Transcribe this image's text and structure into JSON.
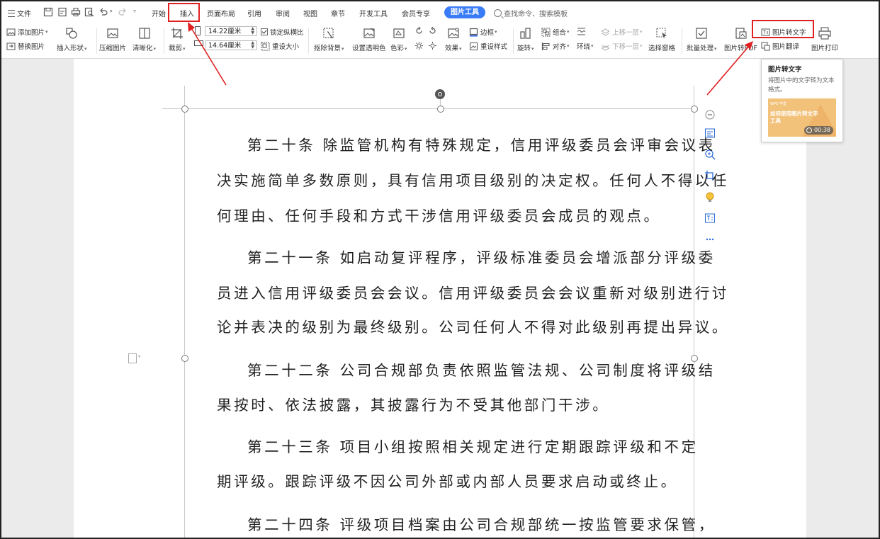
{
  "menubar": {
    "file_label": "文件",
    "tabs": [
      "开始",
      "插入",
      "页面布局",
      "引用",
      "审阅",
      "视图",
      "章节",
      "开发工具",
      "会员专享"
    ],
    "active_context_tab": "图片工具",
    "search_placeholder": "查找命令、搜索模板"
  },
  "ribbon": {
    "add_picture": "添加图片",
    "replace_picture": "替换图片",
    "insert_shape": "插入形状",
    "compress_picture": "压缩图片",
    "sharpen": "清晰化",
    "crop": "裁剪",
    "width_value": "14.22厘米",
    "height_value": "14.64厘米",
    "lock_aspect": "锁定纵横比",
    "reset_size": "重设大小",
    "remove_background": "抠除背景",
    "set_transparent": "设置透明色",
    "color": "色彩",
    "effects": "效果",
    "border": "边框",
    "reset_style": "重设样式",
    "rotate": "旋转",
    "group": "组合",
    "align": "对齐",
    "wrap": "环绕",
    "bring_forward": "上移一层",
    "send_backward": "下移一层",
    "selection_pane": "选择窗格",
    "batch_process": "批量处理",
    "picture_to_pdf": "图片转PDF",
    "picture_to_text": "图片转文字",
    "picture_translate": "图片翻译",
    "picture_print": "图片打印"
  },
  "document": {
    "lines": [
      "第二十条   除监管机构有特殊规定，信用评级委员会评审会议表",
      "决实施简单多数原则，具有信用项目级别的决定权。任何人不得以任",
      "何理由、任何手段和方式干涉信用评级委员会成员的观点。",
      "第二十一条   如启动复评程序，评级标准委员会增派部分评级委",
      "员进入信用评级委员会会议。信用评级委员会会议重新对级别进行讨",
      "论并表决的级别为最终级别。公司任何人不得对此级别再提出异议。",
      "第二十二条   公司合规部负责依照监管法规、公司制度将评级结",
      "果按时、依法披露，其披露行为不受其他部门干涉。",
      "第二十三条   项目小组按照相关规定进行定期跟踪评级和不定",
      "期评级。跟踪评级不因公司外部或内部人员要求启动或终止。",
      "第二十四条   评级项目档案由公司合规部统一按监管要求保管，"
    ]
  },
  "tooltip": {
    "title": "图片转文字",
    "description": "将图片中的文字转为文本格式。",
    "video_small": "WPS 学堂",
    "video_text": "如何使用图片转文字工具",
    "duration": "00:38"
  },
  "colors": {
    "accent": "#3a7bf7",
    "highlight": "#e02020"
  }
}
